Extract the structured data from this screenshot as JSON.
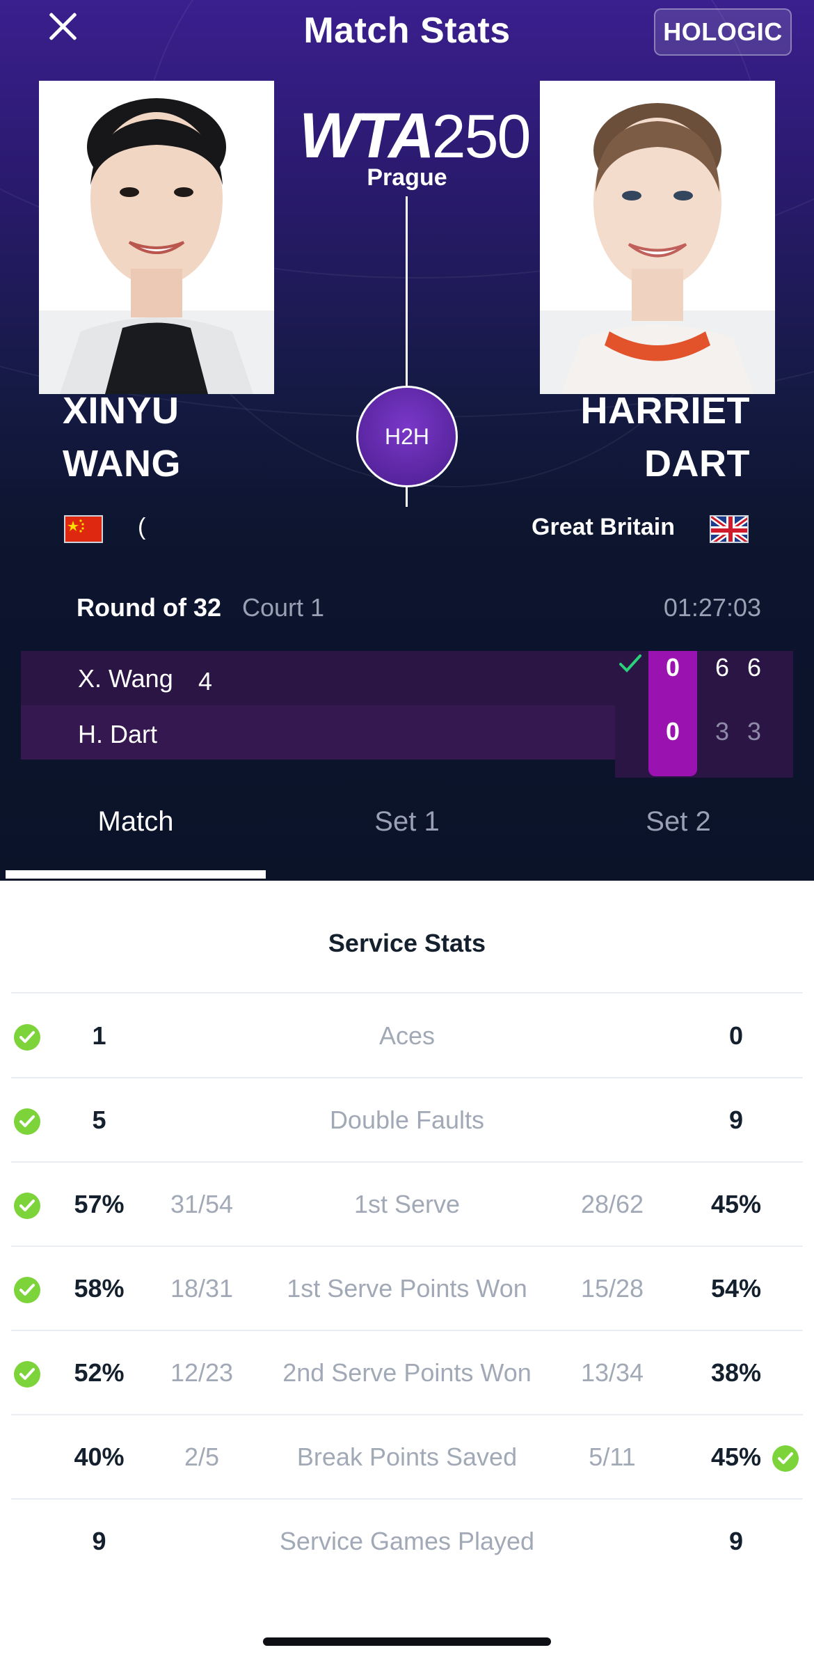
{
  "header": {
    "title": "Match Stats",
    "sponsor": "HOLOGIC",
    "tournament_logo": "WTA",
    "tournament_level": "250",
    "city": "Prague",
    "h2h_label": "H2H"
  },
  "players": {
    "left": {
      "first": "XINYU",
      "last": "WANG",
      "flag": "china-flag-icon"
    },
    "right": {
      "first": "HARRIET",
      "last": "DART",
      "country": "Great Britain",
      "flag": "uk-flag-icon"
    }
  },
  "match_info": {
    "round": "Round of 32",
    "court": "Court 1",
    "duration": "01:27:03"
  },
  "scoreboard": {
    "rows": [
      {
        "name": "X. Wang",
        "game": "4",
        "current": "0",
        "set1": "6",
        "set2": "6",
        "winner": true
      },
      {
        "name": "H. Dart",
        "game": "",
        "current": "0",
        "set1": "3",
        "set2": "3",
        "winner": false
      }
    ]
  },
  "tabs": [
    "Match",
    "Set 1",
    "Set 2"
  ],
  "active_tab": "Match",
  "service_stats": {
    "title": "Service Stats",
    "rows": [
      {
        "label": "Aces",
        "left": "1",
        "left_sub": "",
        "right": "0",
        "right_sub": "",
        "leader": "left"
      },
      {
        "label": "Double Faults",
        "left": "5",
        "left_sub": "",
        "right": "9",
        "right_sub": "",
        "leader": "left"
      },
      {
        "label": "1st Serve",
        "left": "57%",
        "left_sub": "31/54",
        "right": "45%",
        "right_sub": "28/62",
        "leader": "left"
      },
      {
        "label": "1st Serve Points Won",
        "left": "58%",
        "left_sub": "18/31",
        "right": "54%",
        "right_sub": "15/28",
        "leader": "left"
      },
      {
        "label": "2nd Serve Points Won",
        "left": "52%",
        "left_sub": "12/23",
        "right": "38%",
        "right_sub": "13/34",
        "leader": "left"
      },
      {
        "label": "Break Points Saved",
        "left": "40%",
        "left_sub": "2/5",
        "right": "45%",
        "right_sub": "5/11",
        "leader": "right"
      },
      {
        "label": "Service Games Played",
        "left": "9",
        "left_sub": "",
        "right": "9",
        "right_sub": "",
        "leader": "none"
      }
    ]
  },
  "colors": {
    "header_top": "#3a1f8e",
    "header_bottom": "#0b1329",
    "score_highlight": "#9a12b0",
    "check_green": "#7dd33a",
    "text_dark": "#14202e"
  }
}
